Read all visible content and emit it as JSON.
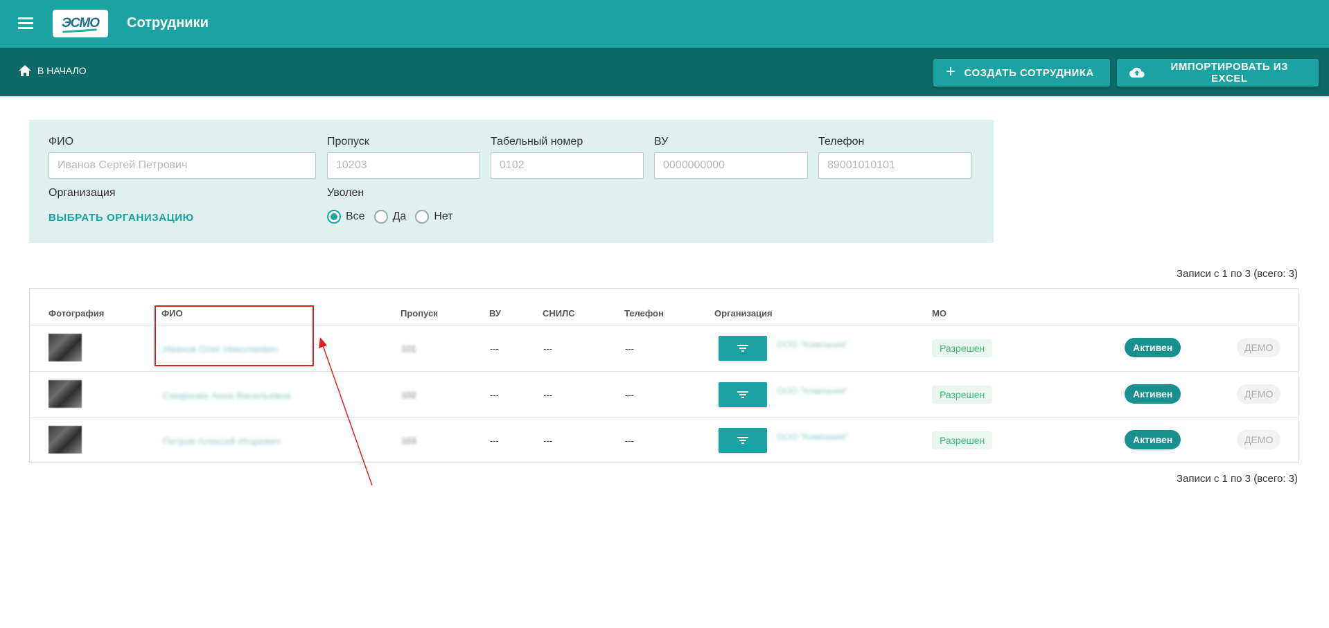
{
  "appbar": {
    "title": "Сотрудники",
    "logo_text": "ЭСМО"
  },
  "toolbar": {
    "home_label": "В НАЧАЛО",
    "create_label": "СОЗДАТЬ СОТРУДНИКА",
    "import_label": "ИМПОРТИРОВАТЬ ИЗ EXCEL"
  },
  "filters": {
    "fio": {
      "label": "ФИО",
      "placeholder": "Иванов Сергей Петрович",
      "value": ""
    },
    "pass": {
      "label": "Пропуск",
      "placeholder": "10203",
      "value": ""
    },
    "tab_number": {
      "label": "Табельный номер",
      "placeholder": "0102",
      "value": ""
    },
    "vu": {
      "label": "ВУ",
      "placeholder": "0000000000",
      "value": ""
    },
    "phone": {
      "label": "Телефон",
      "placeholder": "89001010101",
      "value": ""
    },
    "organization": {
      "label": "Организация",
      "select_label": "ВЫБРАТЬ ОРГАНИЗАЦИЮ"
    },
    "fired": {
      "label": "Уволен",
      "options": [
        "Все",
        "Да",
        "Нет"
      ],
      "selected": "Все"
    }
  },
  "records_info": "Записи с 1 по 3 (всего: 3)",
  "table": {
    "columns": [
      "Фотография",
      "ФИО",
      "Пропуск",
      "ВУ",
      "СНИЛС",
      "Телефон",
      "Организация",
      "МО"
    ],
    "rows": [
      {
        "fio": "Иванов Олег Николаевич",
        "pass": "101",
        "vu": "---",
        "snils": "---",
        "phone": "---",
        "org": "ООО \"Компания\"",
        "mo": "Разрешен",
        "status": "Активен",
        "demo": "ДЕМО"
      },
      {
        "fio": "Смирнова Анна Васильевна",
        "pass": "102",
        "vu": "---",
        "snils": "---",
        "phone": "---",
        "org": "ООО \"Компания\"",
        "mo": "Разрешен",
        "status": "Активен",
        "demo": "ДЕМО"
      },
      {
        "fio": "Петров Алексей Игоревич",
        "pass": "103",
        "vu": "---",
        "snils": "---",
        "phone": "---",
        "org": "ООО \"Компания\"",
        "mo": "Разрешен",
        "status": "Активен",
        "demo": "ДЕМО"
      }
    ]
  },
  "colors": {
    "primary": "#1aa3a2",
    "toolbar": "#0e6a66",
    "filter_bg": "#dff0ef",
    "annotation": "#e02020",
    "mo_green": "#3cb97b"
  },
  "icons": {
    "menu": "menu-icon",
    "home": "home-icon",
    "plus": "plus-icon",
    "cloud_upload": "cloud-upload-icon",
    "filter": "filter-icon"
  }
}
